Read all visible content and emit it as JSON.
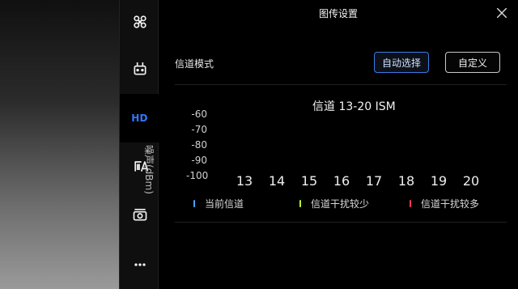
{
  "header": {
    "title": "图传设置"
  },
  "sidebar": {
    "items": [
      {
        "name": "aircraft",
        "icon": "drone-icon"
      },
      {
        "name": "remote-controller",
        "icon": "remote-controller-icon"
      },
      {
        "name": "hd",
        "label": "HD",
        "active": true
      },
      {
        "name": "battery",
        "icon": "battery-icon"
      },
      {
        "name": "camera",
        "icon": "camera-icon"
      },
      {
        "name": "more",
        "icon": "more-dots-icon"
      }
    ]
  },
  "channel_mode": {
    "label": "信道模式",
    "auto_label": "自动选择",
    "custom_label": "自定义",
    "selected": "auto"
  },
  "chart": {
    "title": "信道 13-20 ISM",
    "ylabel": "噪声(dBm)"
  },
  "chart_data": {
    "type": "bar",
    "title": "信道 13-20 ISM",
    "ylabel": "噪声(dBm)",
    "xlabel": "",
    "categories": [
      "13",
      "14",
      "15",
      "16",
      "17",
      "18",
      "19",
      "20"
    ],
    "y_ticks": [
      "-60",
      "-70",
      "-80",
      "-90",
      "-100"
    ],
    "ylim": [
      -100,
      -60
    ],
    "values": [],
    "legend": [
      {
        "label": "当前信道",
        "color": "#4aa3ff"
      },
      {
        "label": "信道干扰较少",
        "color": "#b8ff3a"
      },
      {
        "label": "信道干扰较多",
        "color": "#ff3a5a"
      }
    ]
  },
  "colors": {
    "accent": "#2f78ff",
    "button_border_active": "#3b7be8"
  }
}
